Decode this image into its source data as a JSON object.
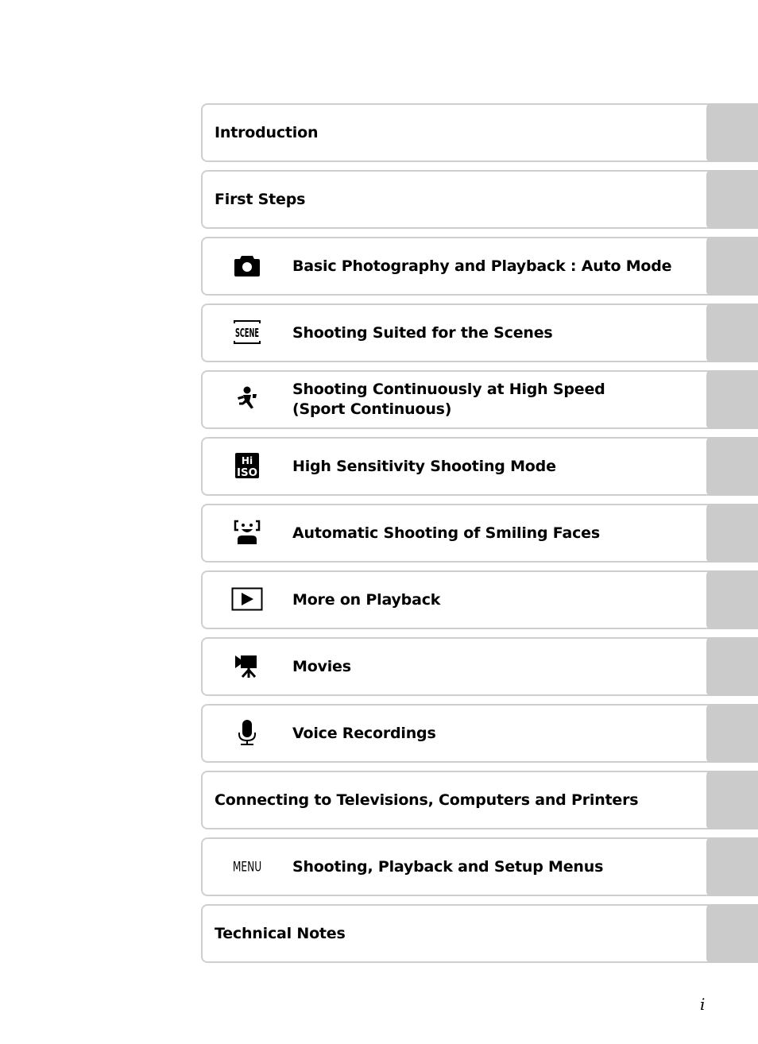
{
  "toc": {
    "items": [
      {
        "label": "Introduction",
        "icon": null
      },
      {
        "label": "First Steps",
        "icon": null
      },
      {
        "label": "Basic Photography and Playback : Auto Mode",
        "icon": "camera-icon"
      },
      {
        "label": "Shooting Suited for the Scenes",
        "icon": "scene-icon",
        "icon_text": "SCENE"
      },
      {
        "label_line1": "Shooting Continuously at High Speed",
        "label_line2": "(Sport Continuous)",
        "icon": "sport-continuous-icon"
      },
      {
        "label": "High Sensitivity Shooting Mode",
        "icon": "hi-iso-icon",
        "icon_text_top": "Hi",
        "icon_text_bottom": "ISO"
      },
      {
        "label": "Automatic Shooting of Smiling Faces",
        "icon": "smile-icon"
      },
      {
        "label": "More on Playback",
        "icon": "playback-icon"
      },
      {
        "label": "Movies",
        "icon": "movie-icon"
      },
      {
        "label": "Voice Recordings",
        "icon": "microphone-icon"
      },
      {
        "label": "Connecting to Televisions, Computers and Printers",
        "icon": null
      },
      {
        "label": "Shooting, Playback and Setup Menus",
        "icon": "menu-icon",
        "icon_text": "MENU"
      },
      {
        "label": "Technical Notes",
        "icon": null
      }
    ]
  },
  "page_number": "i",
  "colors": {
    "border": "#cfcfcf",
    "tab": "#cbcbcb",
    "text": "#000000"
  }
}
